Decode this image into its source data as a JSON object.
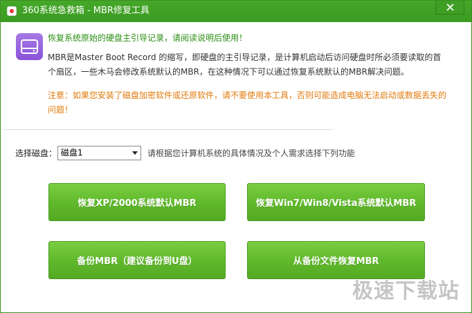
{
  "window": {
    "title": "360系统急救箱 - MBR修复工具"
  },
  "info": {
    "heading": "恢复系统原始的硬盘主引导记录，请阅读说明后使用！",
    "description": "MBR是Master Boot Record 的缩写，即硬盘的主引导记录，是计算机启动后访问硬盘时所必须要读取的首个扇区，一些木马会修改系统默认的MBR，在这种情况下可以通过恢复系统默认的MBR解决问题。",
    "warning": "注意：如果您安装了磁盘加密软件或还原软件，请不要使用本工具，否则可能造成电脑无法启动或数据丢失的问题！"
  },
  "disk": {
    "label": "选择磁盘：",
    "selected": "磁盘1",
    "hint": "请根据您计算机系统的具体情况及个人需求选择下列功能"
  },
  "actions": {
    "restore_xp": "恢复XP/2000系统默认MBR",
    "restore_win7": "恢复Win7/Win8/Vista系统默认MBR",
    "backup": "备份MBR（建议备份到U盘）",
    "restore_from_file": "从备份文件恢复MBR"
  },
  "watermark": {
    "text": "极速下载站"
  },
  "colors": {
    "titlebar": "#3e9f24",
    "heading": "#2a8f13",
    "warning": "#e07a0b",
    "button": "#5fb72b"
  }
}
